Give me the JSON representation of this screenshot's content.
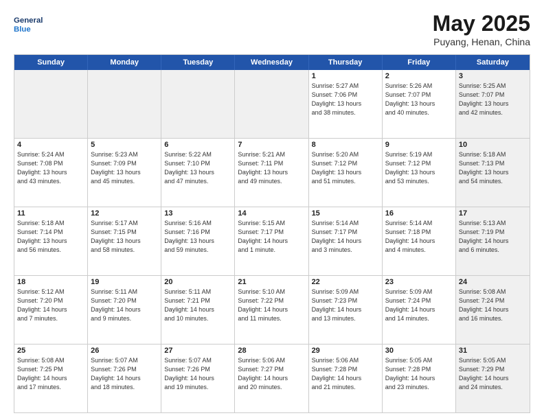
{
  "header": {
    "logo_line1": "General",
    "logo_line2": "Blue",
    "title": "May 2025",
    "subtitle": "Puyang, Henan, China"
  },
  "weekdays": [
    "Sunday",
    "Monday",
    "Tuesday",
    "Wednesday",
    "Thursday",
    "Friday",
    "Saturday"
  ],
  "weeks": [
    [
      {
        "day": "",
        "info": "",
        "shaded": true
      },
      {
        "day": "",
        "info": "",
        "shaded": true
      },
      {
        "day": "",
        "info": "",
        "shaded": true
      },
      {
        "day": "",
        "info": "",
        "shaded": true
      },
      {
        "day": "1",
        "info": "Sunrise: 5:27 AM\nSunset: 7:06 PM\nDaylight: 13 hours\nand 38 minutes."
      },
      {
        "day": "2",
        "info": "Sunrise: 5:26 AM\nSunset: 7:07 PM\nDaylight: 13 hours\nand 40 minutes."
      },
      {
        "day": "3",
        "info": "Sunrise: 5:25 AM\nSunset: 7:07 PM\nDaylight: 13 hours\nand 42 minutes.",
        "shaded": true
      }
    ],
    [
      {
        "day": "4",
        "info": "Sunrise: 5:24 AM\nSunset: 7:08 PM\nDaylight: 13 hours\nand 43 minutes."
      },
      {
        "day": "5",
        "info": "Sunrise: 5:23 AM\nSunset: 7:09 PM\nDaylight: 13 hours\nand 45 minutes."
      },
      {
        "day": "6",
        "info": "Sunrise: 5:22 AM\nSunset: 7:10 PM\nDaylight: 13 hours\nand 47 minutes."
      },
      {
        "day": "7",
        "info": "Sunrise: 5:21 AM\nSunset: 7:11 PM\nDaylight: 13 hours\nand 49 minutes."
      },
      {
        "day": "8",
        "info": "Sunrise: 5:20 AM\nSunset: 7:12 PM\nDaylight: 13 hours\nand 51 minutes."
      },
      {
        "day": "9",
        "info": "Sunrise: 5:19 AM\nSunset: 7:12 PM\nDaylight: 13 hours\nand 53 minutes."
      },
      {
        "day": "10",
        "info": "Sunrise: 5:18 AM\nSunset: 7:13 PM\nDaylight: 13 hours\nand 54 minutes.",
        "shaded": true
      }
    ],
    [
      {
        "day": "11",
        "info": "Sunrise: 5:18 AM\nSunset: 7:14 PM\nDaylight: 13 hours\nand 56 minutes."
      },
      {
        "day": "12",
        "info": "Sunrise: 5:17 AM\nSunset: 7:15 PM\nDaylight: 13 hours\nand 58 minutes."
      },
      {
        "day": "13",
        "info": "Sunrise: 5:16 AM\nSunset: 7:16 PM\nDaylight: 13 hours\nand 59 minutes."
      },
      {
        "day": "14",
        "info": "Sunrise: 5:15 AM\nSunset: 7:17 PM\nDaylight: 14 hours\nand 1 minute."
      },
      {
        "day": "15",
        "info": "Sunrise: 5:14 AM\nSunset: 7:17 PM\nDaylight: 14 hours\nand 3 minutes."
      },
      {
        "day": "16",
        "info": "Sunrise: 5:14 AM\nSunset: 7:18 PM\nDaylight: 14 hours\nand 4 minutes."
      },
      {
        "day": "17",
        "info": "Sunrise: 5:13 AM\nSunset: 7:19 PM\nDaylight: 14 hours\nand 6 minutes.",
        "shaded": true
      }
    ],
    [
      {
        "day": "18",
        "info": "Sunrise: 5:12 AM\nSunset: 7:20 PM\nDaylight: 14 hours\nand 7 minutes."
      },
      {
        "day": "19",
        "info": "Sunrise: 5:11 AM\nSunset: 7:20 PM\nDaylight: 14 hours\nand 9 minutes."
      },
      {
        "day": "20",
        "info": "Sunrise: 5:11 AM\nSunset: 7:21 PM\nDaylight: 14 hours\nand 10 minutes."
      },
      {
        "day": "21",
        "info": "Sunrise: 5:10 AM\nSunset: 7:22 PM\nDaylight: 14 hours\nand 11 minutes."
      },
      {
        "day": "22",
        "info": "Sunrise: 5:09 AM\nSunset: 7:23 PM\nDaylight: 14 hours\nand 13 minutes."
      },
      {
        "day": "23",
        "info": "Sunrise: 5:09 AM\nSunset: 7:24 PM\nDaylight: 14 hours\nand 14 minutes."
      },
      {
        "day": "24",
        "info": "Sunrise: 5:08 AM\nSunset: 7:24 PM\nDaylight: 14 hours\nand 16 minutes.",
        "shaded": true
      }
    ],
    [
      {
        "day": "25",
        "info": "Sunrise: 5:08 AM\nSunset: 7:25 PM\nDaylight: 14 hours\nand 17 minutes."
      },
      {
        "day": "26",
        "info": "Sunrise: 5:07 AM\nSunset: 7:26 PM\nDaylight: 14 hours\nand 18 minutes."
      },
      {
        "day": "27",
        "info": "Sunrise: 5:07 AM\nSunset: 7:26 PM\nDaylight: 14 hours\nand 19 minutes."
      },
      {
        "day": "28",
        "info": "Sunrise: 5:06 AM\nSunset: 7:27 PM\nDaylight: 14 hours\nand 20 minutes."
      },
      {
        "day": "29",
        "info": "Sunrise: 5:06 AM\nSunset: 7:28 PM\nDaylight: 14 hours\nand 21 minutes."
      },
      {
        "day": "30",
        "info": "Sunrise: 5:05 AM\nSunset: 7:28 PM\nDaylight: 14 hours\nand 23 minutes."
      },
      {
        "day": "31",
        "info": "Sunrise: 5:05 AM\nSunset: 7:29 PM\nDaylight: 14 hours\nand 24 minutes.",
        "shaded": true
      }
    ]
  ]
}
